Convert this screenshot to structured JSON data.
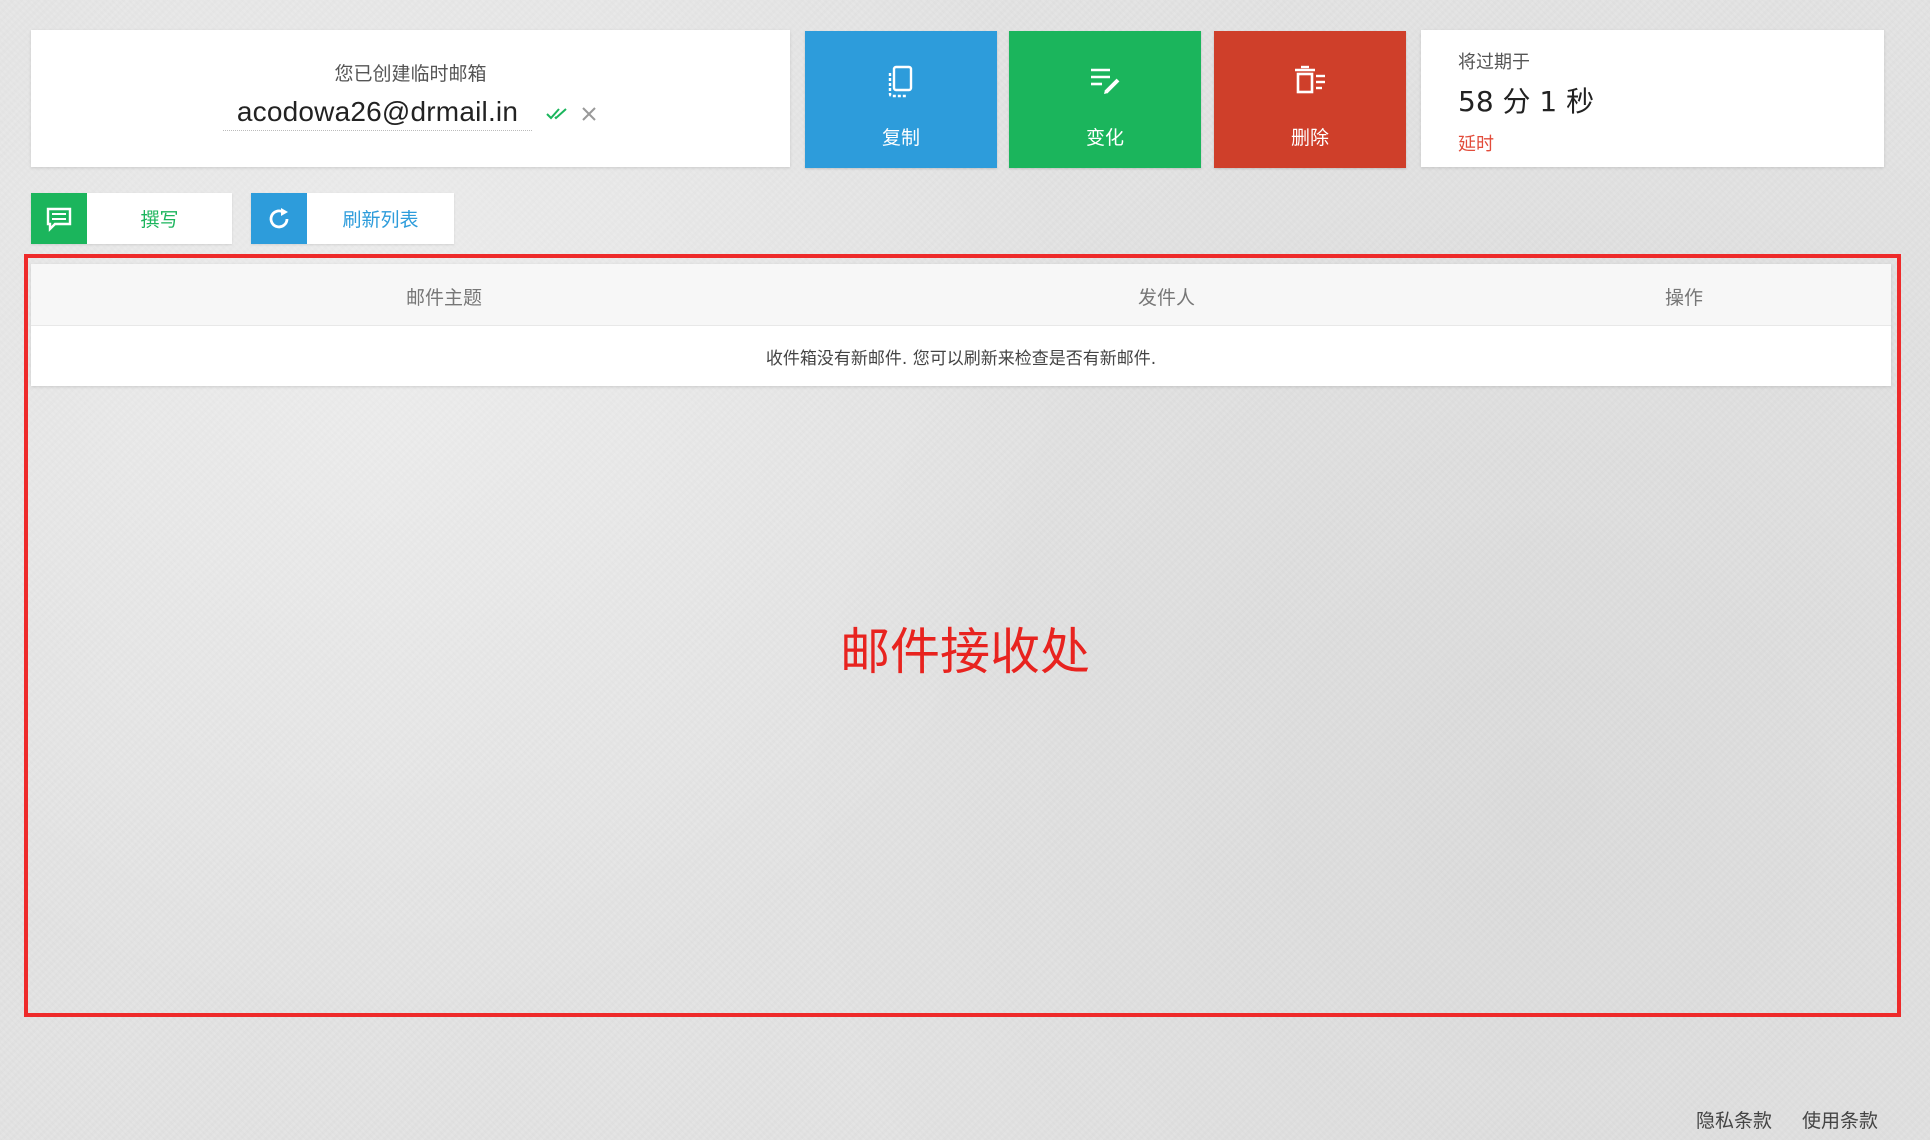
{
  "address_card": {
    "caption": "您已创建临时邮箱",
    "email": "acodowa26@drmail.in",
    "verified_icon": "double-check-icon",
    "clear_icon": "close-icon"
  },
  "actions": {
    "copy_label": "复制",
    "change_label": "变化",
    "delete_label": "删除",
    "copy_icon": "copy-icon",
    "change_icon": "edit-list-icon",
    "delete_icon": "trash-icon"
  },
  "expiry": {
    "label": "将过期于",
    "time": "58 分 1 秒",
    "extend_label": "延时"
  },
  "toolbar": {
    "compose_label": "撰写",
    "refresh_label": "刷新列表"
  },
  "inbox": {
    "columns": [
      "邮件主题",
      "发件人",
      "操作"
    ],
    "empty_message": "收件箱没有新邮件. 您可以刷新来检查是否有新邮件."
  },
  "annotation": {
    "text": "邮件接收处"
  },
  "footer": {
    "links": [
      "隐私条款",
      "使用条款"
    ]
  },
  "colors": {
    "blue": "#2d9cdb",
    "green": "#1bb55c",
    "red": "#cf3f2a",
    "annotation_red": "#ee2a2a",
    "extend_red": "#e24c3b"
  }
}
